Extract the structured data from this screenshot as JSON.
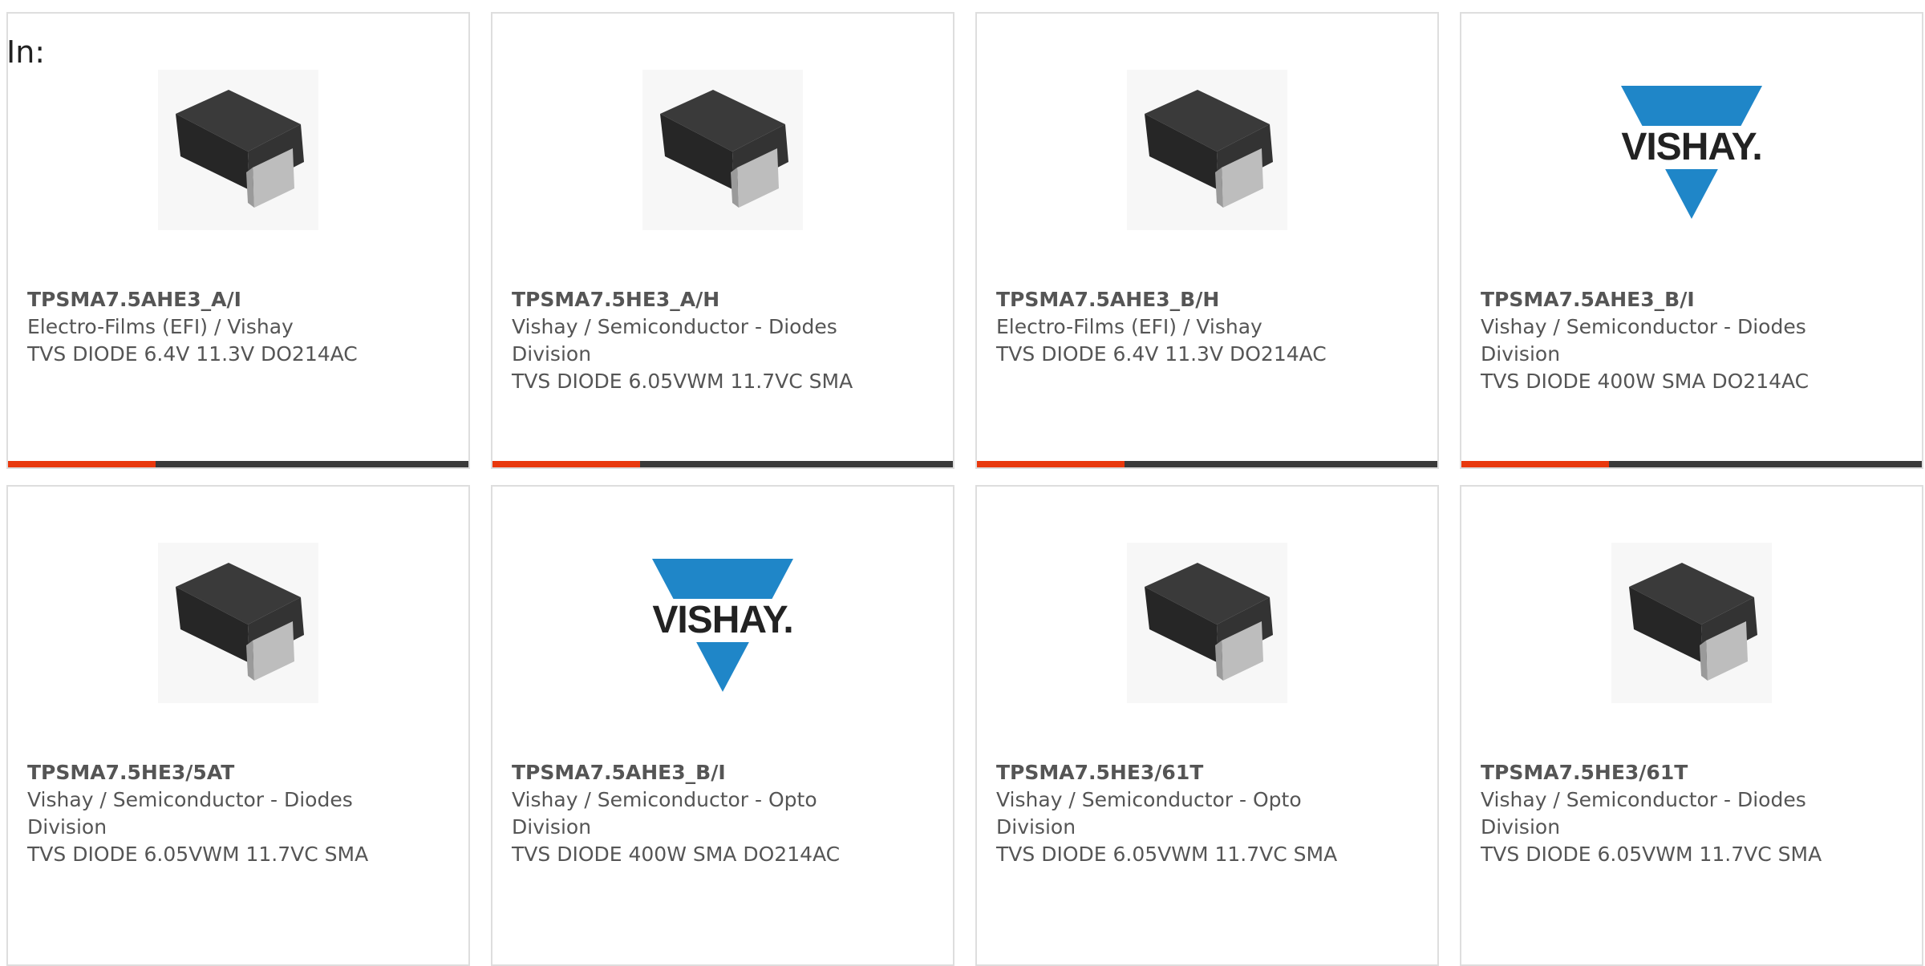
{
  "header": {
    "in_label": "In:"
  },
  "colors": {
    "accent": "#e8380d",
    "bar": "#3a3a3a",
    "vishay_blue": "#1f86c8"
  },
  "products": [
    {
      "part_number": "TPSMA7.5AHE3_A/I",
      "manufacturer": "Electro-Films (EFI) / Vishay",
      "description": "TVS DIODE 6.4V 11.3V DO214AC",
      "image": "sma-diode-package-icon"
    },
    {
      "part_number": "TPSMA7.5HE3_A/H",
      "manufacturer": "Vishay / Semiconductor - Diodes Division",
      "description": "TVS DIODE 6.05VWM 11.7VC SMA",
      "image": "sma-diode-package-icon"
    },
    {
      "part_number": "TPSMA7.5AHE3_B/H",
      "manufacturer": "Electro-Films (EFI) / Vishay",
      "description": "TVS DIODE 6.4V 11.3V DO214AC",
      "image": "sma-diode-package-icon"
    },
    {
      "part_number": "TPSMA7.5AHE3_B/I",
      "manufacturer": "Vishay / Semiconductor - Diodes Division",
      "description": "TVS DIODE 400W SMA DO214AC",
      "image": "vishay-logo",
      "logo_text": "VISHAY."
    },
    {
      "part_number": "TPSMA7.5HE3/5AT",
      "manufacturer": "Vishay / Semiconductor - Diodes Division",
      "description": "TVS DIODE 6.05VWM 11.7VC SMA",
      "image": "sma-diode-package-icon"
    },
    {
      "part_number": "TPSMA7.5AHE3_B/I",
      "manufacturer": "Vishay / Semiconductor - Opto Division",
      "description": "TVS DIODE 400W SMA DO214AC",
      "image": "vishay-logo",
      "logo_text": "VISHAY."
    },
    {
      "part_number": "TPSMA7.5HE3/61T",
      "manufacturer": "Vishay / Semiconductor - Opto Division",
      "description": "TVS DIODE 6.05VWM 11.7VC SMA",
      "image": "sma-diode-package-icon"
    },
    {
      "part_number": "TPSMA7.5HE3/61T",
      "manufacturer": "Vishay / Semiconductor - Diodes Division",
      "description": "TVS DIODE 6.05VWM 11.7VC SMA",
      "image": "sma-diode-package-icon"
    }
  ]
}
